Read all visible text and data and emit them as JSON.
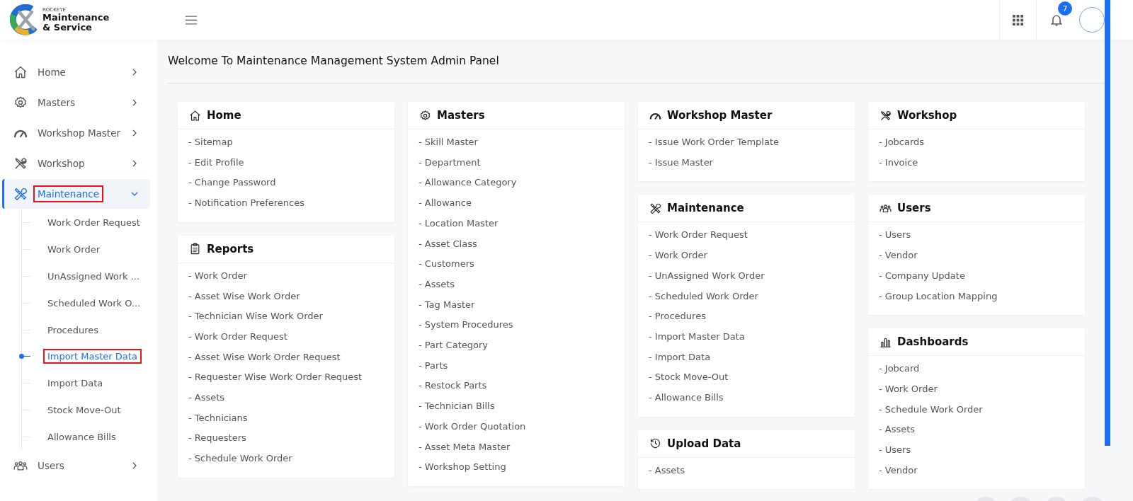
{
  "header": {
    "brand_small": "ROCKEYE",
    "brand_line1": "Maintenance",
    "brand_line2": "& Service",
    "notification_count": "7"
  },
  "sidebar": {
    "items": [
      {
        "label": "Home",
        "kind": "home",
        "expanded": false,
        "selected": false,
        "annotated": false
      },
      {
        "label": "Masters",
        "kind": "gear",
        "expanded": false,
        "selected": false,
        "annotated": false
      },
      {
        "label": "Workshop Master",
        "kind": "gauge",
        "expanded": false,
        "selected": false,
        "annotated": false
      },
      {
        "label": "Workshop",
        "kind": "tools",
        "expanded": false,
        "selected": false,
        "annotated": false
      },
      {
        "label": "Maintenance",
        "kind": "maintenance",
        "expanded": true,
        "selected": true,
        "annotated": true,
        "children": [
          {
            "label": "Work Order Request",
            "selected": false,
            "annotated": false
          },
          {
            "label": "Work Order",
            "selected": false,
            "annotated": false
          },
          {
            "label": "UnAssigned Work ...",
            "selected": false,
            "annotated": false
          },
          {
            "label": "Scheduled Work O...",
            "selected": false,
            "annotated": false
          },
          {
            "label": "Procedures",
            "selected": false,
            "annotated": false
          },
          {
            "label": "Import Master Data",
            "selected": true,
            "annotated": true
          },
          {
            "label": "Import Data",
            "selected": false,
            "annotated": false
          },
          {
            "label": "Stock Move-Out",
            "selected": false,
            "annotated": false
          },
          {
            "label": "Allowance Bills",
            "selected": false,
            "annotated": false
          }
        ]
      },
      {
        "label": "Users",
        "kind": "users",
        "expanded": false,
        "selected": false,
        "annotated": false
      }
    ]
  },
  "page_title": "Welcome To Maintenance Management System Admin Panel",
  "columns": [
    [
      {
        "title": "Home",
        "kind": "home",
        "links": [
          "- Sitemap",
          "- Edit Profile",
          "- Change Password",
          "- Notification Preferences"
        ]
      },
      {
        "title": "Reports",
        "kind": "clipboard",
        "links": [
          "- Work Order",
          "- Asset Wise Work Order",
          "- Technician Wise Work Order",
          "- Work Order Request",
          "- Asset Wise Work Order Request",
          "- Requester Wise Work Order Request",
          "- Assets",
          "- Technicians",
          "- Requesters",
          "- Schedule Work Order"
        ]
      }
    ],
    [
      {
        "title": "Masters",
        "kind": "gear",
        "links": [
          "- Skill Master",
          "- Department",
          "- Allowance Category",
          "- Allowance",
          "- Location Master",
          "- Asset Class",
          "- Customers",
          "- Assets",
          "- Tag Master",
          "- System Procedures",
          "- Part Category",
          "- Parts",
          "- Restock Parts",
          "- Technician Bills",
          "- Work Order Quotation",
          "- Asset Meta Master",
          "- Workshop Setting"
        ]
      }
    ],
    [
      {
        "title": "Workshop Master",
        "kind": "gauge",
        "links": [
          "- Issue Work Order Template",
          "- Issue Master"
        ]
      },
      {
        "title": "Maintenance",
        "kind": "maintenance",
        "links": [
          "- Work Order Request",
          "- Work Order",
          "- UnAssigned Work Order",
          "- Scheduled Work Order",
          "- Procedures",
          "- Import Master Data",
          "- Import Data",
          "- Stock Move-Out",
          "- Allowance Bills"
        ]
      },
      {
        "title": "Upload Data",
        "kind": "history",
        "links": [
          "- Assets"
        ]
      }
    ],
    [
      {
        "title": "Workshop",
        "kind": "tools",
        "links": [
          "- Jobcards",
          "- Invoice"
        ]
      },
      {
        "title": "Users",
        "kind": "users",
        "links": [
          "- Users",
          "- Vendor",
          "- Company Update",
          "- Group Location Mapping"
        ]
      },
      {
        "title": "Dashboards",
        "kind": "chart",
        "links": [
          "- Jobcard",
          "- Work Order",
          "- Schedule Work Order",
          "- Assets",
          "- Users",
          "- Vendor"
        ]
      }
    ]
  ]
}
